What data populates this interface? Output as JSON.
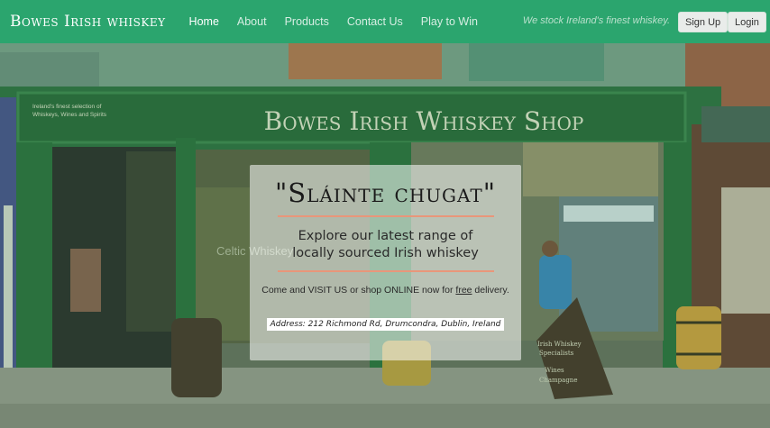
{
  "brand": "Bowes Irish whiskey",
  "nav": {
    "items": [
      {
        "label": "Home",
        "active": true
      },
      {
        "label": "About",
        "active": false
      },
      {
        "label": "Products",
        "active": false
      },
      {
        "label": "Contact Us",
        "active": false
      },
      {
        "label": "Play to Win",
        "active": false
      }
    ],
    "tagline": "We stock Ireland's finest whiskey.",
    "signup_label": "Sign Up",
    "login_label": "Login"
  },
  "hero": {
    "sign_text": "Bowes Irish Whiskey Shop",
    "sign_small": [
      "Ireland's finest selection of",
      "Whiskeys, Wines and Spirits"
    ],
    "aboard_text": [
      "Irish Whiskey",
      "Specialists",
      "Wines",
      "Champagne"
    ],
    "window_text": "Celtic Whiskey",
    "card": {
      "title": "\"Sláinte chugat\"",
      "subtitle_line1": "Explore our latest range of",
      "subtitle_line2": "locally sourced Irish whiskey",
      "visit_before": "Come and VISIT US or shop ONLINE now for ",
      "visit_link": "free",
      "visit_after": " delivery.",
      "address": "Address: 212 Richmond Rd, Drumcondra, Dublin, Ireland"
    }
  },
  "colors": {
    "navbar": "#2ba56e",
    "shopfront_green": "#2f6a3a",
    "accent_rule": "#e9967a"
  }
}
